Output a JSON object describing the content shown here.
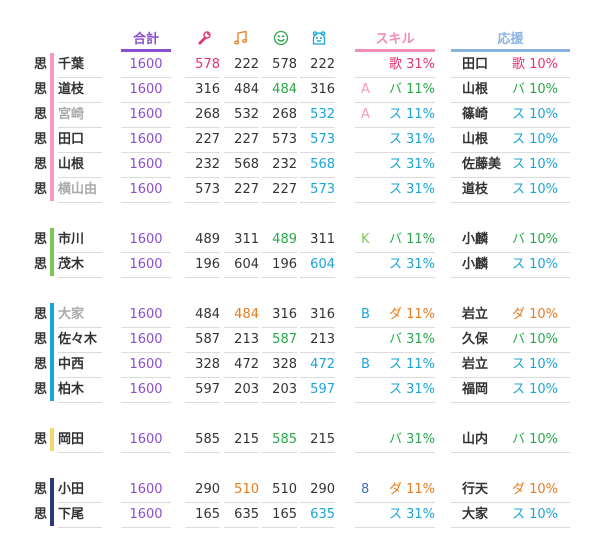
{
  "colors": {
    "total": "#8a4ecf",
    "vocal": "#e8336e",
    "dance": "#e77b1e",
    "visual": "#2aa84a",
    "mental": "#1aa5d8",
    "skill_line": "#f08cb8",
    "support_line": "#8ab4e0",
    "grey_name": "#aaaaaa",
    "dark": "#333333"
  },
  "headers": {
    "total": "合計",
    "skill": "スキル",
    "support": "応援"
  },
  "icons": [
    "mic-icon",
    "music-note-icon",
    "smile-icon",
    "bear-icon"
  ],
  "groups": [
    {
      "color": "#f49ac1",
      "rows": [
        {
          "tag": "思",
          "name": "千葉",
          "name_color": "#333333",
          "total": "1600",
          "stats": [
            {
              "v": "578",
              "c": "#e8336e"
            },
            {
              "v": "222",
              "c": "#333333"
            },
            {
              "v": "578",
              "c": "#333333"
            },
            {
              "v": "222",
              "c": "#333333"
            }
          ],
          "skill_prefix": "",
          "skill_prefix_color": "#333333",
          "skill": "歌 31%",
          "skill_color": "#e8336e",
          "sup_name": "田口",
          "sup": "歌 10%",
          "sup_color": "#e8336e"
        },
        {
          "tag": "思",
          "name": "道枝",
          "name_color": "#333333",
          "total": "1600",
          "stats": [
            {
              "v": "316",
              "c": "#333333"
            },
            {
              "v": "484",
              "c": "#333333"
            },
            {
              "v": "484",
              "c": "#2aa84a"
            },
            {
              "v": "316",
              "c": "#333333"
            }
          ],
          "skill_prefix": "A",
          "skill_prefix_color": "#f49ac1",
          "skill": "バ 11%",
          "skill_color": "#2aa84a",
          "sup_name": "山根",
          "sup": "バ 10%",
          "sup_color": "#2aa84a"
        },
        {
          "tag": "思",
          "name": "宮崎",
          "name_color": "#aaaaaa",
          "total": "1600",
          "stats": [
            {
              "v": "268",
              "c": "#333333"
            },
            {
              "v": "532",
              "c": "#333333"
            },
            {
              "v": "268",
              "c": "#333333"
            },
            {
              "v": "532",
              "c": "#1aa5d8"
            }
          ],
          "skill_prefix": "A",
          "skill_prefix_color": "#f49ac1",
          "skill": "ス 11%",
          "skill_color": "#1aa5d8",
          "sup_name": "篠崎",
          "sup": "ス 10%",
          "sup_color": "#1aa5d8"
        },
        {
          "tag": "思",
          "name": "田口",
          "name_color": "#333333",
          "total": "1600",
          "stats": [
            {
              "v": "227",
              "c": "#333333"
            },
            {
              "v": "227",
              "c": "#333333"
            },
            {
              "v": "573",
              "c": "#333333"
            },
            {
              "v": "573",
              "c": "#1aa5d8"
            }
          ],
          "skill_prefix": "",
          "skill_prefix_color": "#333333",
          "skill": "ス 31%",
          "skill_color": "#1aa5d8",
          "sup_name": "山根",
          "sup": "ス 10%",
          "sup_color": "#1aa5d8"
        },
        {
          "tag": "思",
          "name": "山根",
          "name_color": "#333333",
          "total": "1600",
          "stats": [
            {
              "v": "232",
              "c": "#333333"
            },
            {
              "v": "568",
              "c": "#333333"
            },
            {
              "v": "232",
              "c": "#333333"
            },
            {
              "v": "568",
              "c": "#1aa5d8"
            }
          ],
          "skill_prefix": "",
          "skill_prefix_color": "#333333",
          "skill": "ス 31%",
          "skill_color": "#1aa5d8",
          "sup_name": "佐藤美",
          "sup": "ス 10%",
          "sup_color": "#1aa5d8"
        },
        {
          "tag": "思",
          "name": "横山由",
          "name_color": "#aaaaaa",
          "total": "1600",
          "stats": [
            {
              "v": "573",
              "c": "#333333"
            },
            {
              "v": "227",
              "c": "#333333"
            },
            {
              "v": "227",
              "c": "#333333"
            },
            {
              "v": "573",
              "c": "#1aa5d8"
            }
          ],
          "skill_prefix": "",
          "skill_prefix_color": "#333333",
          "skill": "ス 31%",
          "skill_color": "#1aa5d8",
          "sup_name": "道枝",
          "sup": "ス 10%",
          "sup_color": "#1aa5d8"
        }
      ]
    },
    {
      "color": "#7dc65a",
      "rows": [
        {
          "tag": "思",
          "name": "市川",
          "name_color": "#333333",
          "total": "1600",
          "stats": [
            {
              "v": "489",
              "c": "#333333"
            },
            {
              "v": "311",
              "c": "#333333"
            },
            {
              "v": "489",
              "c": "#2aa84a"
            },
            {
              "v": "311",
              "c": "#333333"
            }
          ],
          "skill_prefix": "K",
          "skill_prefix_color": "#7dc65a",
          "skill": "バ 11%",
          "skill_color": "#2aa84a",
          "sup_name": "小麟",
          "sup": "バ 10%",
          "sup_color": "#2aa84a"
        },
        {
          "tag": "思",
          "name": "茂木",
          "name_color": "#333333",
          "total": "1600",
          "stats": [
            {
              "v": "196",
              "c": "#333333"
            },
            {
              "v": "604",
              "c": "#333333"
            },
            {
              "v": "196",
              "c": "#333333"
            },
            {
              "v": "604",
              "c": "#1aa5d8"
            }
          ],
          "skill_prefix": "",
          "skill_prefix_color": "#333333",
          "skill": "ス 31%",
          "skill_color": "#1aa5d8",
          "sup_name": "小麟",
          "sup": "ス 10%",
          "sup_color": "#1aa5d8"
        }
      ]
    },
    {
      "color": "#1aa5d8",
      "rows": [
        {
          "tag": "思",
          "name": "大家",
          "name_color": "#aaaaaa",
          "total": "1600",
          "stats": [
            {
              "v": "484",
              "c": "#333333"
            },
            {
              "v": "484",
              "c": "#e77b1e"
            },
            {
              "v": "316",
              "c": "#333333"
            },
            {
              "v": "316",
              "c": "#333333"
            }
          ],
          "skill_prefix": "B",
          "skill_prefix_color": "#1aa5d8",
          "skill": "ダ 11%",
          "skill_color": "#e77b1e",
          "sup_name": "岩立",
          "sup": "ダ 10%",
          "sup_color": "#e77b1e"
        },
        {
          "tag": "思",
          "name": "佐々木",
          "name_color": "#333333",
          "total": "1600",
          "stats": [
            {
              "v": "587",
              "c": "#333333"
            },
            {
              "v": "213",
              "c": "#333333"
            },
            {
              "v": "587",
              "c": "#2aa84a"
            },
            {
              "v": "213",
              "c": "#333333"
            }
          ],
          "skill_prefix": "",
          "skill_prefix_color": "#333333",
          "skill": "バ 31%",
          "skill_color": "#2aa84a",
          "sup_name": "久保",
          "sup": "バ 10%",
          "sup_color": "#2aa84a"
        },
        {
          "tag": "思",
          "name": "中西",
          "name_color": "#333333",
          "total": "1600",
          "stats": [
            {
              "v": "328",
              "c": "#333333"
            },
            {
              "v": "472",
              "c": "#333333"
            },
            {
              "v": "328",
              "c": "#333333"
            },
            {
              "v": "472",
              "c": "#1aa5d8"
            }
          ],
          "skill_prefix": "B",
          "skill_prefix_color": "#1aa5d8",
          "skill": "ス 11%",
          "skill_color": "#1aa5d8",
          "sup_name": "岩立",
          "sup": "ス 10%",
          "sup_color": "#1aa5d8"
        },
        {
          "tag": "思",
          "name": "柏木",
          "name_color": "#333333",
          "total": "1600",
          "stats": [
            {
              "v": "597",
              "c": "#333333"
            },
            {
              "v": "203",
              "c": "#333333"
            },
            {
              "v": "203",
              "c": "#333333"
            },
            {
              "v": "597",
              "c": "#1aa5d8"
            }
          ],
          "skill_prefix": "",
          "skill_prefix_color": "#333333",
          "skill": "ス 31%",
          "skill_color": "#1aa5d8",
          "sup_name": "福岡",
          "sup": "ス 10%",
          "sup_color": "#1aa5d8"
        }
      ]
    },
    {
      "color": "#f5d76e",
      "rows": [
        {
          "tag": "思",
          "name": "岡田",
          "name_color": "#333333",
          "total": "1600",
          "stats": [
            {
              "v": "585",
              "c": "#333333"
            },
            {
              "v": "215",
              "c": "#333333"
            },
            {
              "v": "585",
              "c": "#2aa84a"
            },
            {
              "v": "215",
              "c": "#333333"
            }
          ],
          "skill_prefix": "",
          "skill_prefix_color": "#333333",
          "skill": "バ 31%",
          "skill_color": "#2aa84a",
          "sup_name": "山内",
          "sup": "バ 10%",
          "sup_color": "#2aa84a"
        }
      ]
    },
    {
      "color": "#2a3a7a",
      "rows": [
        {
          "tag": "思",
          "name": "小田",
          "name_color": "#333333",
          "total": "1600",
          "stats": [
            {
              "v": "290",
              "c": "#333333"
            },
            {
              "v": "510",
              "c": "#e77b1e"
            },
            {
              "v": "510",
              "c": "#333333"
            },
            {
              "v": "290",
              "c": "#333333"
            }
          ],
          "skill_prefix": "8",
          "skill_prefix_color": "#3a6ec8",
          "skill": "ダ 11%",
          "skill_color": "#e77b1e",
          "sup_name": "行天",
          "sup": "ダ 10%",
          "sup_color": "#e77b1e"
        },
        {
          "tag": "思",
          "name": "下尾",
          "name_color": "#333333",
          "total": "1600",
          "stats": [
            {
              "v": "165",
              "c": "#333333"
            },
            {
              "v": "635",
              "c": "#333333"
            },
            {
              "v": "165",
              "c": "#333333"
            },
            {
              "v": "635",
              "c": "#1aa5d8"
            }
          ],
          "skill_prefix": "",
          "skill_prefix_color": "#333333",
          "skill": "ス 31%",
          "skill_color": "#1aa5d8",
          "sup_name": "大家",
          "sup": "ス 10%",
          "sup_color": "#1aa5d8"
        }
      ]
    }
  ]
}
